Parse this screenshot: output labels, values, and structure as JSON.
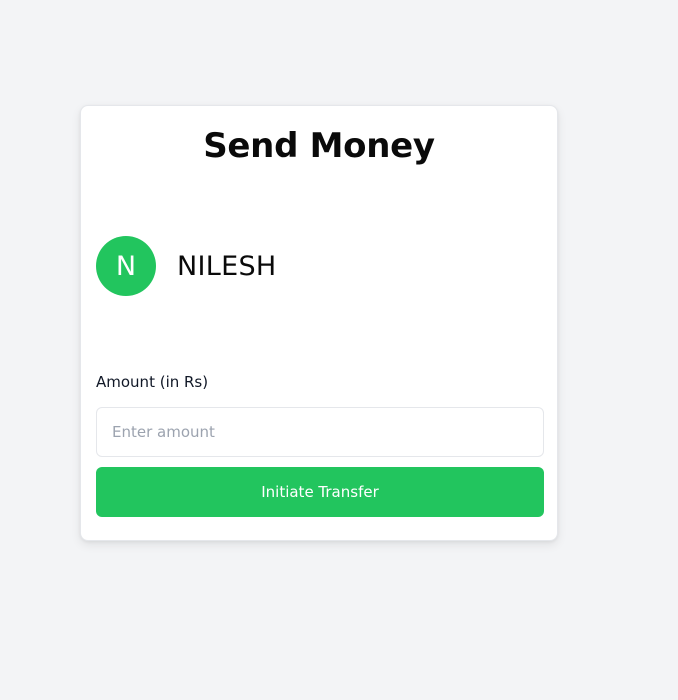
{
  "title": "Send Money",
  "recipient": {
    "initial": "N",
    "name": "NILESH",
    "avatar_color": "#22c55e"
  },
  "amount": {
    "label": "Amount (in Rs)",
    "value": "",
    "placeholder": "Enter amount"
  },
  "actions": {
    "transfer_label": "Initiate Transfer",
    "accent_color": "#22c55e"
  }
}
